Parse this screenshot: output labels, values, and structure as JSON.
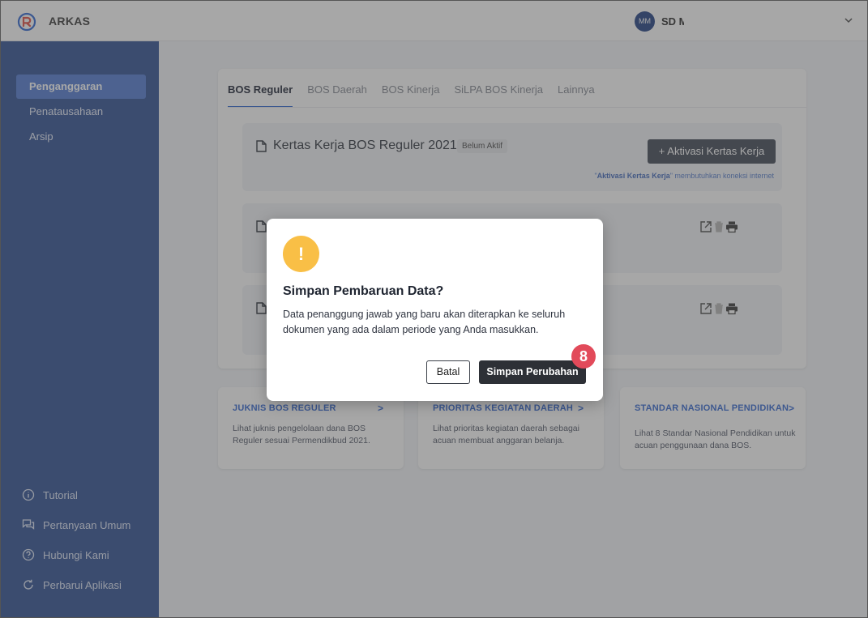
{
  "app": {
    "brand": "ARKAS"
  },
  "user": {
    "initials": "MM",
    "school_visible": "SD M"
  },
  "sidebar": {
    "items": [
      {
        "label": "Penganggaran"
      },
      {
        "label": "Penatausahaan"
      },
      {
        "label": "Arsip"
      }
    ],
    "footer": [
      {
        "label": "Tutorial",
        "icon": "info-icon"
      },
      {
        "label": "Pertanyaan Umum",
        "icon": "chat-icon"
      },
      {
        "label": "Hubungi Kami",
        "icon": "help-icon"
      },
      {
        "label": "Perbarui Aplikasi",
        "icon": "refresh-icon"
      }
    ]
  },
  "tabs": [
    {
      "label": "BOS Reguler"
    },
    {
      "label": "BOS Daerah"
    },
    {
      "label": "BOS Kinerja"
    },
    {
      "label": "SiLPA BOS Kinerja"
    },
    {
      "label": "Lainnya"
    }
  ],
  "worksheet": {
    "title": "Kertas Kerja BOS Reguler 2021",
    "status": "Belum Aktif",
    "activate_button": "+ Aktivasi Kertas Kerja",
    "note_quote_open": "\"",
    "note_bold": "Aktivasi Kertas Kerja",
    "note_rest": "\" membutuhkan koneksi internet"
  },
  "info_cards": [
    {
      "title": "JUKNIS BOS REGULER",
      "arrow": ">",
      "desc": "Lihat juknis pengelolaan dana BOS Reguler sesuai Permendikbud 2021."
    },
    {
      "title": "PRIORITAS KEGIATAN DAERAH",
      "arrow": ">",
      "desc": "Lihat prioritas kegiatan daerah sebagai acuan membuat anggaran belanja."
    },
    {
      "title": "STANDAR NASIONAL PENDIDIKAN",
      "arrow": ">",
      "desc": "Lihat 8 Standar Nasional Pendidikan untuk acuan penggunaan dana BOS."
    }
  ],
  "dialog": {
    "icon": "!",
    "title": "Simpan Pembaruan Data?",
    "message": "Data penanggung jawab yang baru akan diterapkan ke seluruh dokumen yang ada dalam periode yang Anda masukkan.",
    "cancel_label": "Batal",
    "save_label": "Simpan Perubahan"
  },
  "step_badge": "8",
  "colors": {
    "sidebar": "#3b5a9a",
    "sidebar_active": "#5b82d6",
    "accent_blue": "#3e6fd4",
    "warning": "#f9bf46",
    "primary_button": "#2d3036",
    "step_badge": "#e24a5a"
  }
}
